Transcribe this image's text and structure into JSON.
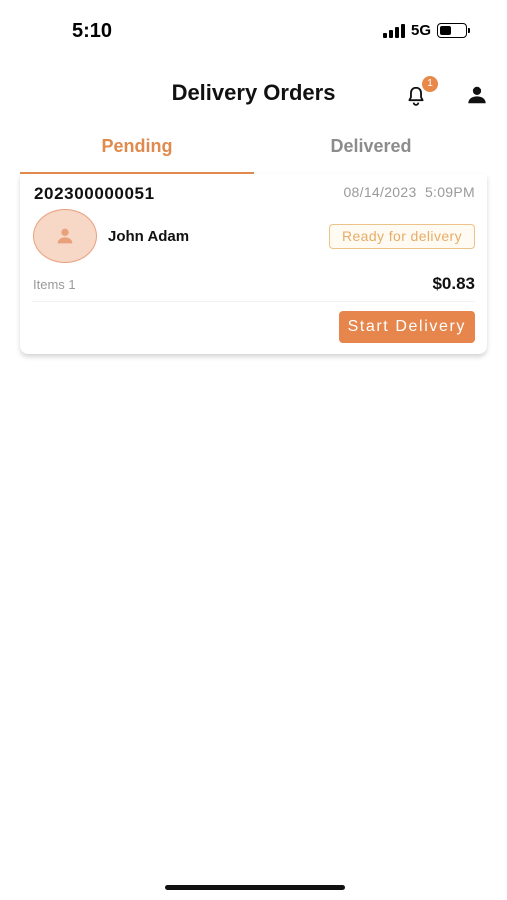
{
  "status_bar": {
    "time": "5:10",
    "network": "5G"
  },
  "header": {
    "title": "Delivery Orders",
    "notification_count": "1",
    "bell_icon": "bell-icon",
    "profile_icon": "user-icon"
  },
  "tabs": [
    {
      "label": "Pending",
      "active": true
    },
    {
      "label": "Delivered",
      "active": false
    }
  ],
  "order": {
    "id": "202300000051",
    "date": "08/14/2023",
    "time": "5:09PM",
    "customer_name": "John Adam",
    "status": "Ready for delivery",
    "items_label": "Items 1",
    "total": "$0.83",
    "action_label": "Start Delivery"
  },
  "colors": {
    "accent": "#e6864d",
    "status_text": "#e7ad66",
    "avatar_bg": "#f7d7c6",
    "muted_text": "#9a9a9a"
  }
}
